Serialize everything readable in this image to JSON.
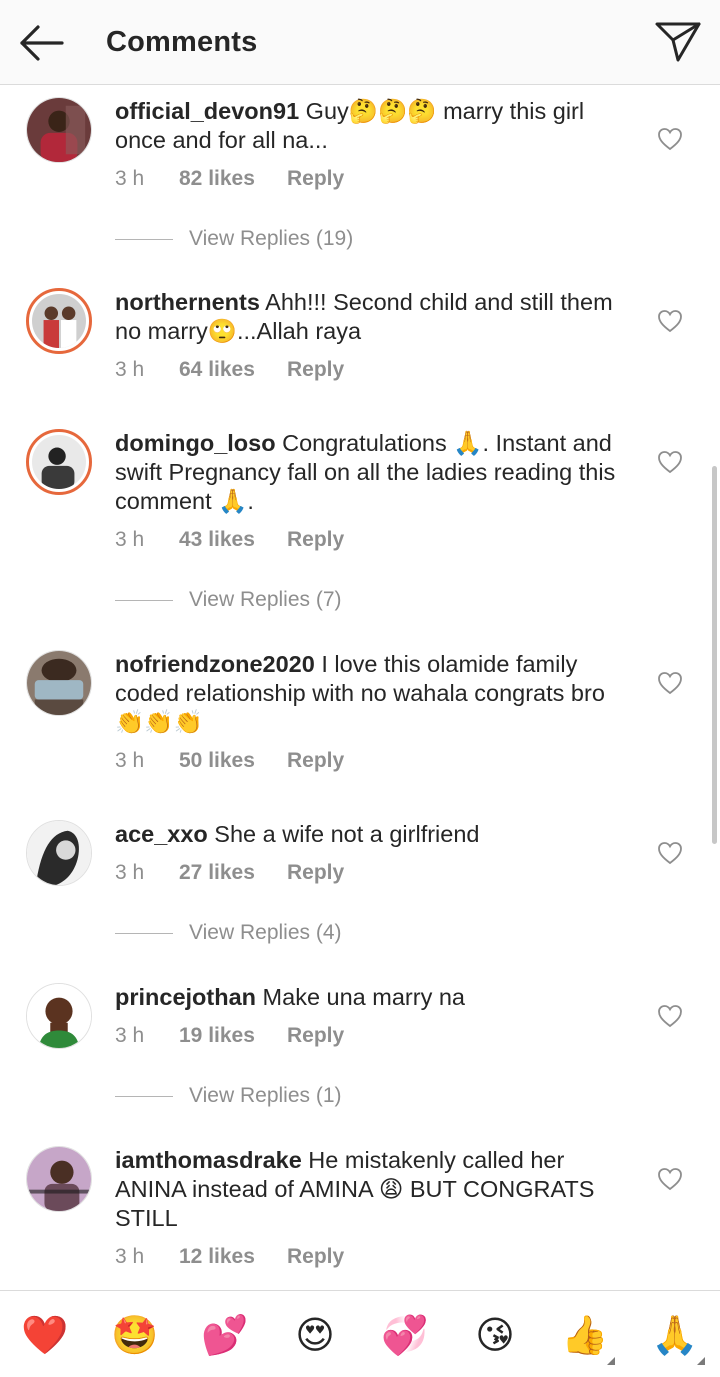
{
  "header": {
    "title": "Comments",
    "back_icon": "arrow-left-icon",
    "send_icon": "paper-plane-icon"
  },
  "comments": [
    {
      "username": "official_devon91",
      "text": " Guy🤔🤔🤔 marry this girl once and for all na...",
      "time": "3 h",
      "likes": "82 likes",
      "reply": "Reply",
      "view_replies": "View Replies (19)"
    },
    {
      "username": "northernents",
      "text": " Ahh!!! Second child and still them no marry🙄...Allah raya",
      "time": "3 h",
      "likes": "64 likes",
      "reply": "Reply"
    },
    {
      "username": "domingo_loso",
      "text": " Congratulations 🙏. Instant and swift Pregnancy fall on all the ladies reading this comment 🙏.",
      "time": "3 h",
      "likes": "43 likes",
      "reply": "Reply",
      "view_replies": "View Replies (7)"
    },
    {
      "username": "nofriendzone2020",
      "text": " I love this olamide family coded relationship with no wahala congrats bro 👏👏👏",
      "time": "3 h",
      "likes": "50 likes",
      "reply": "Reply"
    },
    {
      "username": "ace_xxo",
      "text": " She a wife not a girlfriend",
      "time": "3 h",
      "likes": "27 likes",
      "reply": "Reply",
      "view_replies": "View Replies (4)"
    },
    {
      "username": "princejothan",
      "text": " Make una marry na",
      "time": "3 h",
      "likes": "19 likes",
      "reply": "Reply",
      "view_replies": "View Replies (1)"
    },
    {
      "username": "iamthomasdrake",
      "text": " He mistakenly called her ANINA instead of AMINA 😩 BUT CONGRATS STILL",
      "time": "3 h",
      "likes": "12 likes",
      "reply": "Reply"
    }
  ],
  "emoji_bar": [
    "❤️",
    "🤩",
    "💕",
    "😍",
    "💞",
    "😘",
    "👍",
    "🙏"
  ],
  "colors": {
    "story_ring": "#e6683c",
    "meta_text": "#8e8e8e",
    "heart_red": "#ed4956"
  }
}
